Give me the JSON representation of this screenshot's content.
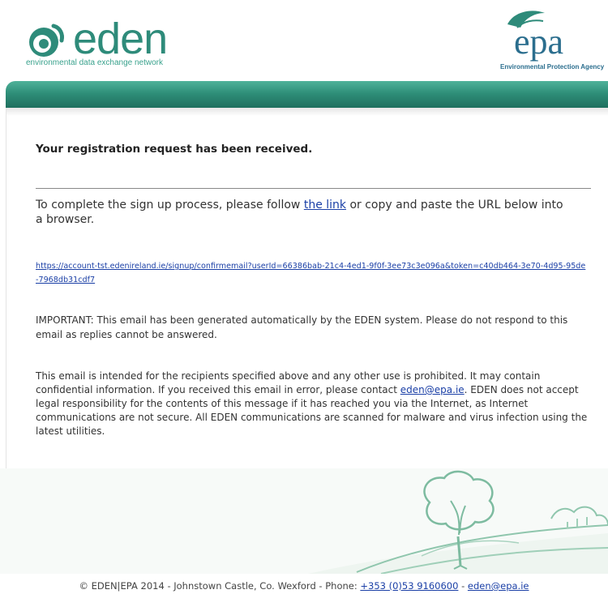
{
  "header": {
    "brand_left": "eden",
    "brand_left_tagline": "environmental data exchange network",
    "brand_right": "epa",
    "brand_right_tagline": "Environmental Protection Agency"
  },
  "email": {
    "headline": "Your registration request has been received.",
    "instruction_before": "To complete the sign up process, please follow ",
    "instruction_link": "the link",
    "instruction_after": " or copy and paste the URL below into a browser.",
    "confirm_url": "https://account-tst.edenireland.ie/signup/confirmemail?userId=66386bab-21c4-4ed1-9f0f-3ee73c3e096a&token=c40db464-3e70-4d95-95de-7968db31cdf7",
    "important": "IMPORTANT: This email has been generated automatically by the EDEN system. Please do not respond to this email as replies cannot be answered.",
    "disclaimer_before": "This email is intended for the recipients specified above and any other use is prohibited. It may contain confidential information. If you received this email in error, please contact ",
    "disclaimer_email": "eden@epa.ie",
    "disclaimer_after": ". EDEN does not accept legal responsibility for the contents of this message if it has reached you via the Internet, as Internet communications are not secure. All EDEN communications are scanned for malware and virus infection using the latest utilities."
  },
  "footer": {
    "text_before": "© EDEN|EPA 2014 - Johnstown Castle, Co. Wexford - Phone: ",
    "phone": "+353 (0)53 9160600",
    "separator": " - ",
    "email": "eden@epa.ie"
  },
  "colors": {
    "brand_green": "#2e8b7a",
    "epa_blue": "#2b6e8e",
    "link_blue": "#1a3fa6"
  },
  "icons": [
    "eden-swirl-icon",
    "epa-leaf-icon",
    "tree-landscape-illustration"
  ]
}
